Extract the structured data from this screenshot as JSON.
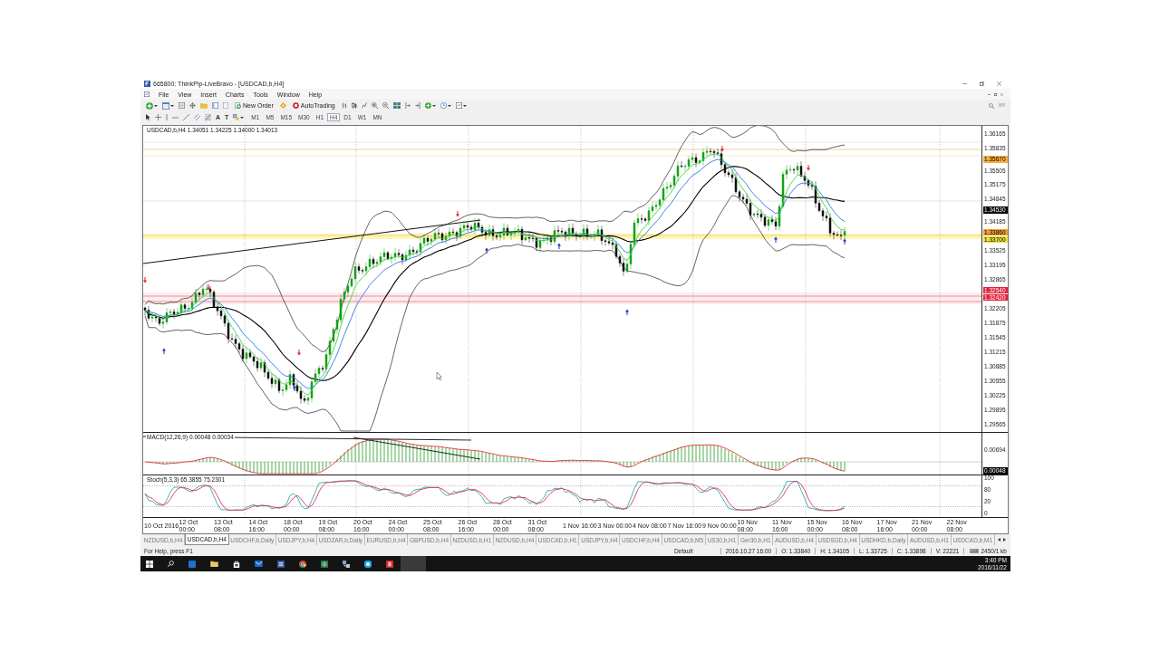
{
  "window": {
    "title": "665800: ThinkPip-LiveBravo - [USDCAD,b,H4]"
  },
  "menu": [
    "File",
    "View",
    "Insert",
    "Charts",
    "Tools",
    "Window",
    "Help"
  ],
  "toolbar": {
    "buttons": [
      {
        "kind": "order",
        "label": "New Order"
      },
      {
        "kind": "autotrading",
        "label": "AutoTrading"
      }
    ]
  },
  "drawing_toolbar": {
    "text_tools": [
      "A",
      "T"
    ],
    "timeframes": [
      {
        "label": "M1",
        "selected": false
      },
      {
        "label": "M5",
        "selected": false
      },
      {
        "label": "M15",
        "selected": false
      },
      {
        "label": "M30",
        "selected": false
      },
      {
        "label": "H1",
        "selected": false
      },
      {
        "label": "H4",
        "selected": true
      },
      {
        "label": "D1",
        "selected": false
      },
      {
        "label": "W1",
        "selected": false
      },
      {
        "label": "MN",
        "selected": false
      }
    ]
  },
  "chart": {
    "legend": "USDCAD,b,H4 1.34051 1.34225 1.34000 1.34013",
    "price_axis": [
      {
        "kind": "tick",
        "text": "1.36165"
      },
      {
        "kind": "tick",
        "text": "1.35835"
      },
      {
        "kind": "tag",
        "text": "1.35670",
        "color": "#f5b041"
      },
      {
        "kind": "tick",
        "text": "1.35505"
      },
      {
        "kind": "tick",
        "text": "1.35175"
      },
      {
        "kind": "tick",
        "text": "1.34845"
      },
      {
        "kind": "tag",
        "text": "1.34530",
        "color": "#000000"
      },
      {
        "kind": "tick",
        "text": "1.34185"
      },
      {
        "kind": "tag",
        "text": "1.33860",
        "color": "#f0a030"
      },
      {
        "kind": "tag",
        "text": "1.33700",
        "color": "#e8e040"
      },
      {
        "kind": "tick",
        "text": "1.33525"
      },
      {
        "kind": "tick",
        "text": "1.33195"
      },
      {
        "kind": "tick",
        "text": "1.32865"
      },
      {
        "kind": "tag",
        "text": "1.32540",
        "color": "#e0203a"
      },
      {
        "kind": "tag",
        "text": "1.32420",
        "color": "#e0203a"
      },
      {
        "kind": "tick",
        "text": "1.32205"
      },
      {
        "kind": "tick",
        "text": "1.31875"
      },
      {
        "kind": "tick",
        "text": "1.31545"
      },
      {
        "kind": "tick",
        "text": "1.31215"
      },
      {
        "kind": "tick",
        "text": "1.30885"
      },
      {
        "kind": "tick",
        "text": "1.30555"
      },
      {
        "kind": "tick",
        "text": "1.30225"
      },
      {
        "kind": "tick",
        "text": "1.29895"
      },
      {
        "kind": "tick",
        "text": "1.29565"
      }
    ],
    "time_axis": [
      "10 Oct 2016",
      "12 Oct 00:00",
      "13 Oct 08:00",
      "14 Oct 16:00",
      "18 Oct 00:00",
      "19 Oct 08:00",
      "20 Oct 16:00",
      "24 Oct 00:00",
      "25 Oct 08:00",
      "26 Oct 16:00",
      "28 Oct 00:00",
      "31 Oct 08:00",
      "1 Nov 16:00",
      "3 Nov 00:00",
      "4 Nov 08:00",
      "7 Nov 16:00",
      "9 Nov 00:00",
      "10 Nov 08:00",
      "11 Nov 16:00",
      "15 Nov 00:00",
      "16 Nov 08:00",
      "17 Nov 16:00",
      "21 Nov 00:00",
      "22 Nov 08:00"
    ]
  },
  "macd": {
    "legend": "MACD(12,26,9) 0.00048 0.00034",
    "axis": [
      {
        "kind": "tick",
        "text": "0.00694"
      },
      {
        "kind": "tag",
        "text": "0.00048",
        "color": "#000000"
      }
    ]
  },
  "stochastic": {
    "legend": "Stoch(5,3,3) 65.3855 75.2301",
    "axis": [
      "100",
      "80",
      "20",
      "0"
    ]
  },
  "tabs": [
    {
      "label": "NZDUSD,b,H4",
      "selected": false
    },
    {
      "label": "USDCAD,b,H4",
      "selected": true
    },
    {
      "label": "USDCHF,b,Daily",
      "selected": false
    },
    {
      "label": "USDJPY,b,H4",
      "selected": false
    },
    {
      "label": "USDZAR,b,Daily",
      "selected": false
    },
    {
      "label": "EURUSD,b,H4",
      "selected": false
    },
    {
      "label": "GBPUSD,b,H4",
      "selected": false
    },
    {
      "label": "NZDUSD,b,H1",
      "selected": false
    },
    {
      "label": "NZDUSD,b,H4",
      "selected": false
    },
    {
      "label": "USDCAD,b,H1",
      "selected": false
    },
    {
      "label": "USDJPY,b,H4",
      "selected": false
    },
    {
      "label": "USDCHF,b,H4",
      "selected": false
    },
    {
      "label": "USDCAD,b,M5",
      "selected": false
    },
    {
      "label": "US30,b,H1",
      "selected": false
    },
    {
      "label": "Ger30,b,H1",
      "selected": false
    },
    {
      "label": "AUDUSD,b,H4",
      "selected": false
    },
    {
      "label": "USDSGD,b,H4",
      "selected": false
    },
    {
      "label": "USDHKD,b,Daily",
      "selected": false
    },
    {
      "label": "AUDUSD,b,H1",
      "selected": false
    },
    {
      "label": "USDCAD,b,M1",
      "selected": false
    }
  ],
  "status_bar": {
    "help": "For Help, press F1",
    "profile": "Default",
    "fields": [
      "2016.10.27 16:00",
      "O: 1.33840",
      "H: 1.34105",
      "L: 1.33725",
      "C: 1.33898",
      "V: 22221"
    ],
    "traffic": "2450/1 kb"
  },
  "taskbar": {
    "clock": {
      "time": "3:40 PM",
      "date": "2016/11/22"
    }
  }
}
